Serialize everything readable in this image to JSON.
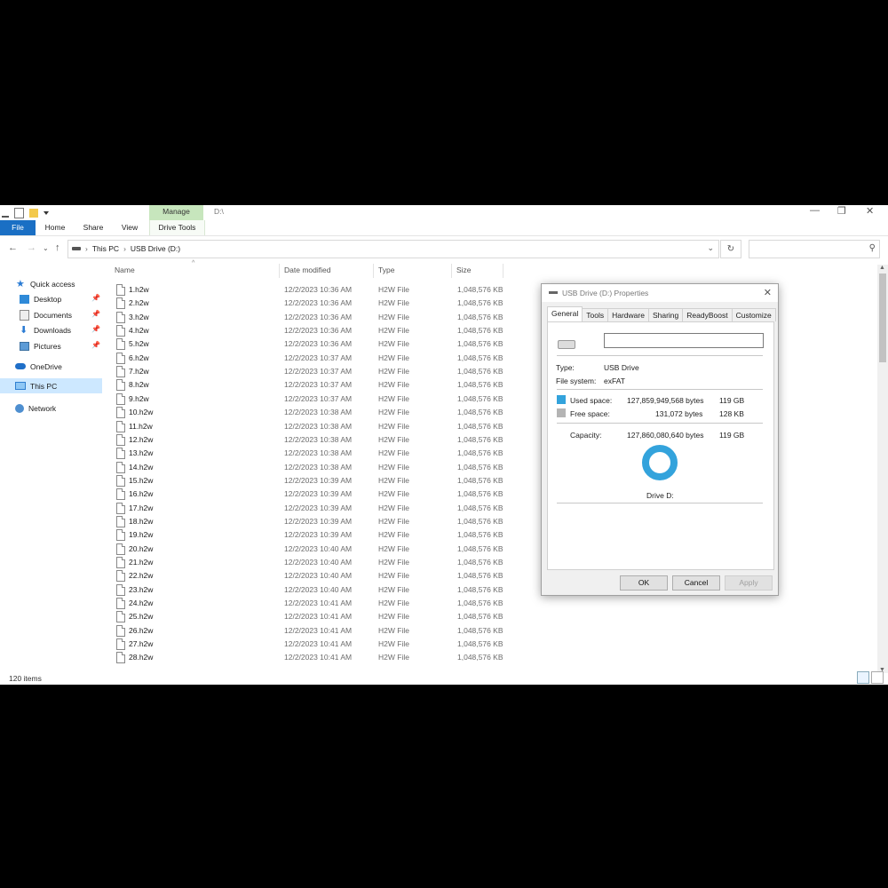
{
  "window": {
    "title": "D:\\",
    "manage_tab": "Manage",
    "ribbon_tabs": [
      "File",
      "Home",
      "Share",
      "View",
      "Drive Tools"
    ],
    "controls": {
      "minimize": "—",
      "restore": "❐",
      "close": "✕"
    }
  },
  "address": {
    "crumbs": [
      "This PC",
      "USB Drive (D:)"
    ],
    "search_placeholder": ""
  },
  "nav": {
    "quick_access": "Quick access",
    "items": [
      "Desktop",
      "Documents",
      "Downloads",
      "Pictures"
    ],
    "onedrive": "OneDrive",
    "this_pc": "This PC",
    "network": "Network"
  },
  "columns": {
    "name": "Name",
    "date": "Date modified",
    "type": "Type",
    "size": "Size"
  },
  "files": [
    {
      "name": "1.h2w",
      "date": "12/2/2023 10:36 AM",
      "type": "H2W File",
      "size": "1,048,576 KB"
    },
    {
      "name": "2.h2w",
      "date": "12/2/2023 10:36 AM",
      "type": "H2W File",
      "size": "1,048,576 KB"
    },
    {
      "name": "3.h2w",
      "date": "12/2/2023 10:36 AM",
      "type": "H2W File",
      "size": "1,048,576 KB"
    },
    {
      "name": "4.h2w",
      "date": "12/2/2023 10:36 AM",
      "type": "H2W File",
      "size": "1,048,576 KB"
    },
    {
      "name": "5.h2w",
      "date": "12/2/2023 10:36 AM",
      "type": "H2W File",
      "size": "1,048,576 KB"
    },
    {
      "name": "6.h2w",
      "date": "12/2/2023 10:37 AM",
      "type": "H2W File",
      "size": "1,048,576 KB"
    },
    {
      "name": "7.h2w",
      "date": "12/2/2023 10:37 AM",
      "type": "H2W File",
      "size": "1,048,576 KB"
    },
    {
      "name": "8.h2w",
      "date": "12/2/2023 10:37 AM",
      "type": "H2W File",
      "size": "1,048,576 KB"
    },
    {
      "name": "9.h2w",
      "date": "12/2/2023 10:37 AM",
      "type": "H2W File",
      "size": "1,048,576 KB"
    },
    {
      "name": "10.h2w",
      "date": "12/2/2023 10:38 AM",
      "type": "H2W File",
      "size": "1,048,576 KB"
    },
    {
      "name": "11.h2w",
      "date": "12/2/2023 10:38 AM",
      "type": "H2W File",
      "size": "1,048,576 KB"
    },
    {
      "name": "12.h2w",
      "date": "12/2/2023 10:38 AM",
      "type": "H2W File",
      "size": "1,048,576 KB"
    },
    {
      "name": "13.h2w",
      "date": "12/2/2023 10:38 AM",
      "type": "H2W File",
      "size": "1,048,576 KB"
    },
    {
      "name": "14.h2w",
      "date": "12/2/2023 10:38 AM",
      "type": "H2W File",
      "size": "1,048,576 KB"
    },
    {
      "name": "15.h2w",
      "date": "12/2/2023 10:39 AM",
      "type": "H2W File",
      "size": "1,048,576 KB"
    },
    {
      "name": "16.h2w",
      "date": "12/2/2023 10:39 AM",
      "type": "H2W File",
      "size": "1,048,576 KB"
    },
    {
      "name": "17.h2w",
      "date": "12/2/2023 10:39 AM",
      "type": "H2W File",
      "size": "1,048,576 KB"
    },
    {
      "name": "18.h2w",
      "date": "12/2/2023 10:39 AM",
      "type": "H2W File",
      "size": "1,048,576 KB"
    },
    {
      "name": "19.h2w",
      "date": "12/2/2023 10:39 AM",
      "type": "H2W File",
      "size": "1,048,576 KB"
    },
    {
      "name": "20.h2w",
      "date": "12/2/2023 10:40 AM",
      "type": "H2W File",
      "size": "1,048,576 KB"
    },
    {
      "name": "21.h2w",
      "date": "12/2/2023 10:40 AM",
      "type": "H2W File",
      "size": "1,048,576 KB"
    },
    {
      "name": "22.h2w",
      "date": "12/2/2023 10:40 AM",
      "type": "H2W File",
      "size": "1,048,576 KB"
    },
    {
      "name": "23.h2w",
      "date": "12/2/2023 10:40 AM",
      "type": "H2W File",
      "size": "1,048,576 KB"
    },
    {
      "name": "24.h2w",
      "date": "12/2/2023 10:41 AM",
      "type": "H2W File",
      "size": "1,048,576 KB"
    },
    {
      "name": "25.h2w",
      "date": "12/2/2023 10:41 AM",
      "type": "H2W File",
      "size": "1,048,576 KB"
    },
    {
      "name": "26.h2w",
      "date": "12/2/2023 10:41 AM",
      "type": "H2W File",
      "size": "1,048,576 KB"
    },
    {
      "name": "27.h2w",
      "date": "12/2/2023 10:41 AM",
      "type": "H2W File",
      "size": "1,048,576 KB"
    },
    {
      "name": "28.h2w",
      "date": "12/2/2023 10:41 AM",
      "type": "H2W File",
      "size": "1,048,576 KB"
    }
  ],
  "status": {
    "item_count": "120 items"
  },
  "dialog": {
    "title": "USB Drive (D:) Properties",
    "tabs": [
      "General",
      "Tools",
      "Hardware",
      "Sharing",
      "ReadyBoost",
      "Customize"
    ],
    "drive_label_value": "",
    "type_label": "Type:",
    "type_value": "USB Drive",
    "fs_label": "File system:",
    "fs_value": "exFAT",
    "used_label": "Used space:",
    "used_bytes": "127,859,949,568 bytes",
    "used_gb": "119 GB",
    "free_label": "Free space:",
    "free_bytes": "131,072 bytes",
    "free_kb": "128 KB",
    "capacity_label": "Capacity:",
    "capacity_bytes": "127,860,080,640 bytes",
    "capacity_gb": "119 GB",
    "drive_caption": "Drive D:",
    "ok": "OK",
    "cancel": "Cancel",
    "apply": "Apply",
    "colors": {
      "used": "#33a3dc",
      "free": "#b4b4b4"
    }
  }
}
